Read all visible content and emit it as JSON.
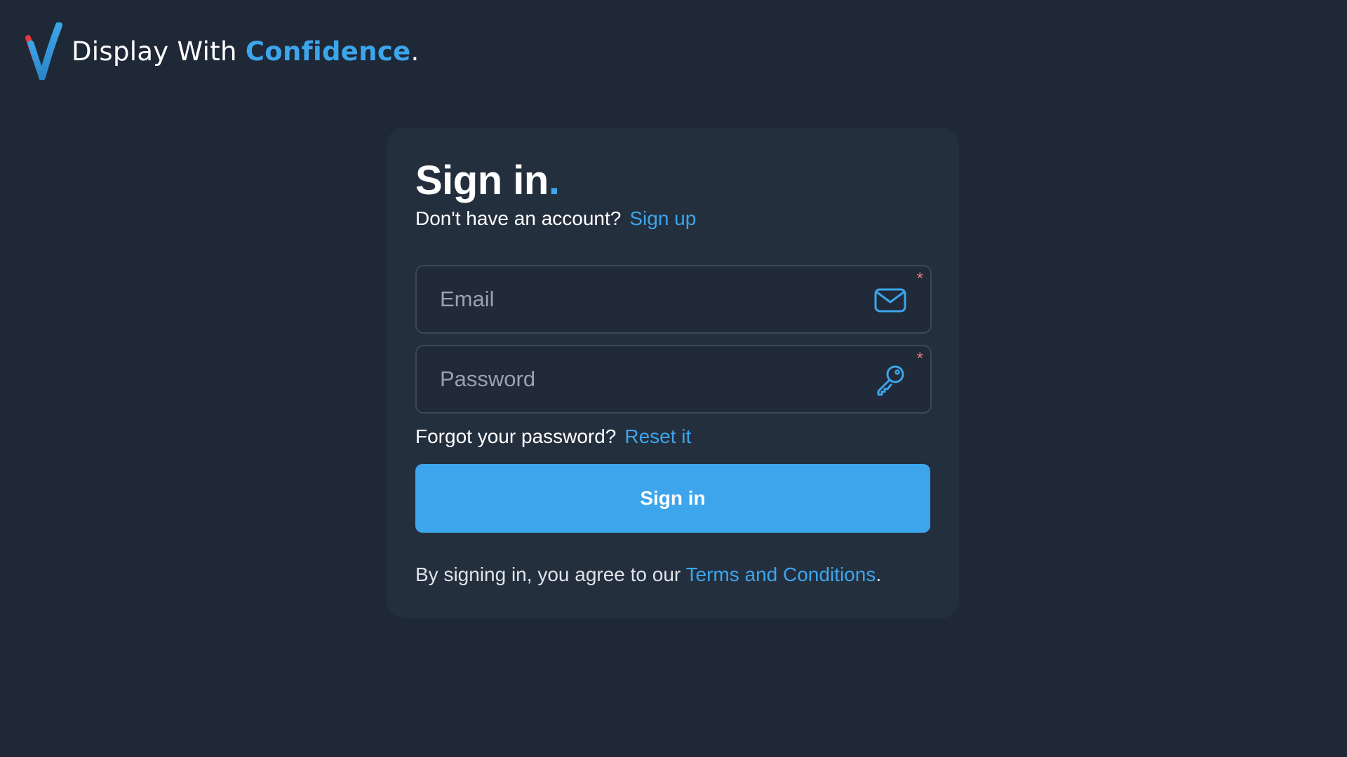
{
  "brand": {
    "text_main": "Display With ",
    "text_accent": "Confidence",
    "text_suffix": ".",
    "logo_icon": "v-checkmark-logo"
  },
  "signin": {
    "title": "Sign in",
    "title_dot": ".",
    "no_account_text": "Don't have an account?",
    "signup_link": "Sign up",
    "email": {
      "placeholder": "Email",
      "value": "",
      "icon": "mail-icon",
      "required_mark": "*"
    },
    "password": {
      "placeholder": "Password",
      "value": "",
      "icon": "key-icon",
      "required_mark": "*"
    },
    "forgot_text": "Forgot your password?",
    "reset_link": "Reset it",
    "button_label": "Sign in",
    "terms_prefix": "By signing in, you agree to our ",
    "terms_link": "Terms and Conditions",
    "terms_suffix": "."
  },
  "colors": {
    "background": "#1f2836",
    "card": "#242f3e",
    "accent": "#3ca5eb",
    "required": "#e77a7a",
    "logo_red": "#e23a3a"
  }
}
